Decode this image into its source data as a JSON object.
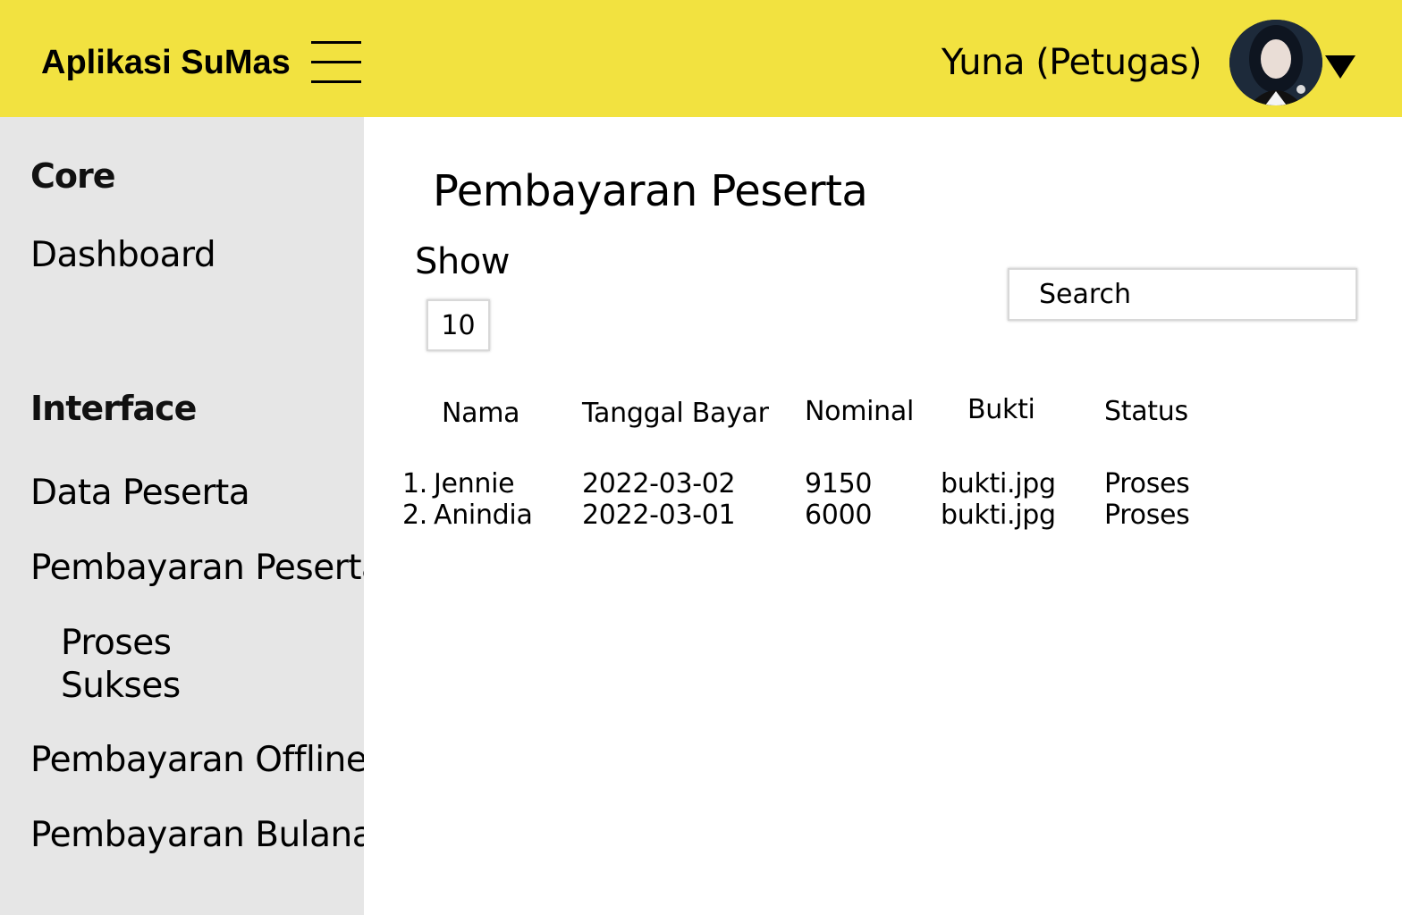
{
  "header": {
    "app_title": "Aplikasi SuMas",
    "user_label": "Yuna (Petugas)",
    "accent_color": "#F2E240"
  },
  "sidebar": {
    "section_core": "Core",
    "dashboard": "Dashboard",
    "section_interface": "Interface",
    "data_peserta": "Data Peserta",
    "pembayaran_peserta": "Pembayaran Peserta",
    "sub_proses": "Proses",
    "sub_sukses": "Sukses",
    "pembayaran_offline": "Pembayaran Offline",
    "pembayaran_bulanan": "Pembayaran Bulanan"
  },
  "main": {
    "title": "Pembayaran Peserta",
    "show_label": "Show",
    "show_value": "10",
    "search_placeholder": "Search",
    "table": {
      "headers": [
        "Nama",
        "Tanggal Bayar",
        "Nominal",
        "Bukti",
        "Status"
      ],
      "rows": [
        {
          "no": "1.",
          "nama": "Jennie",
          "tanggal": "2022-03-02",
          "nominal": "9150",
          "bukti": "bukti.jpg",
          "status": "Proses"
        },
        {
          "no": "2.",
          "nama": "Anindia",
          "tanggal": "2022-03-01",
          "nominal": "6000",
          "bukti": "bukti.jpg",
          "status": "Proses"
        }
      ]
    }
  },
  "icons": {
    "menu": "hamburger-icon",
    "avatar": "user-avatar",
    "dropdown": "caret-down-icon"
  }
}
